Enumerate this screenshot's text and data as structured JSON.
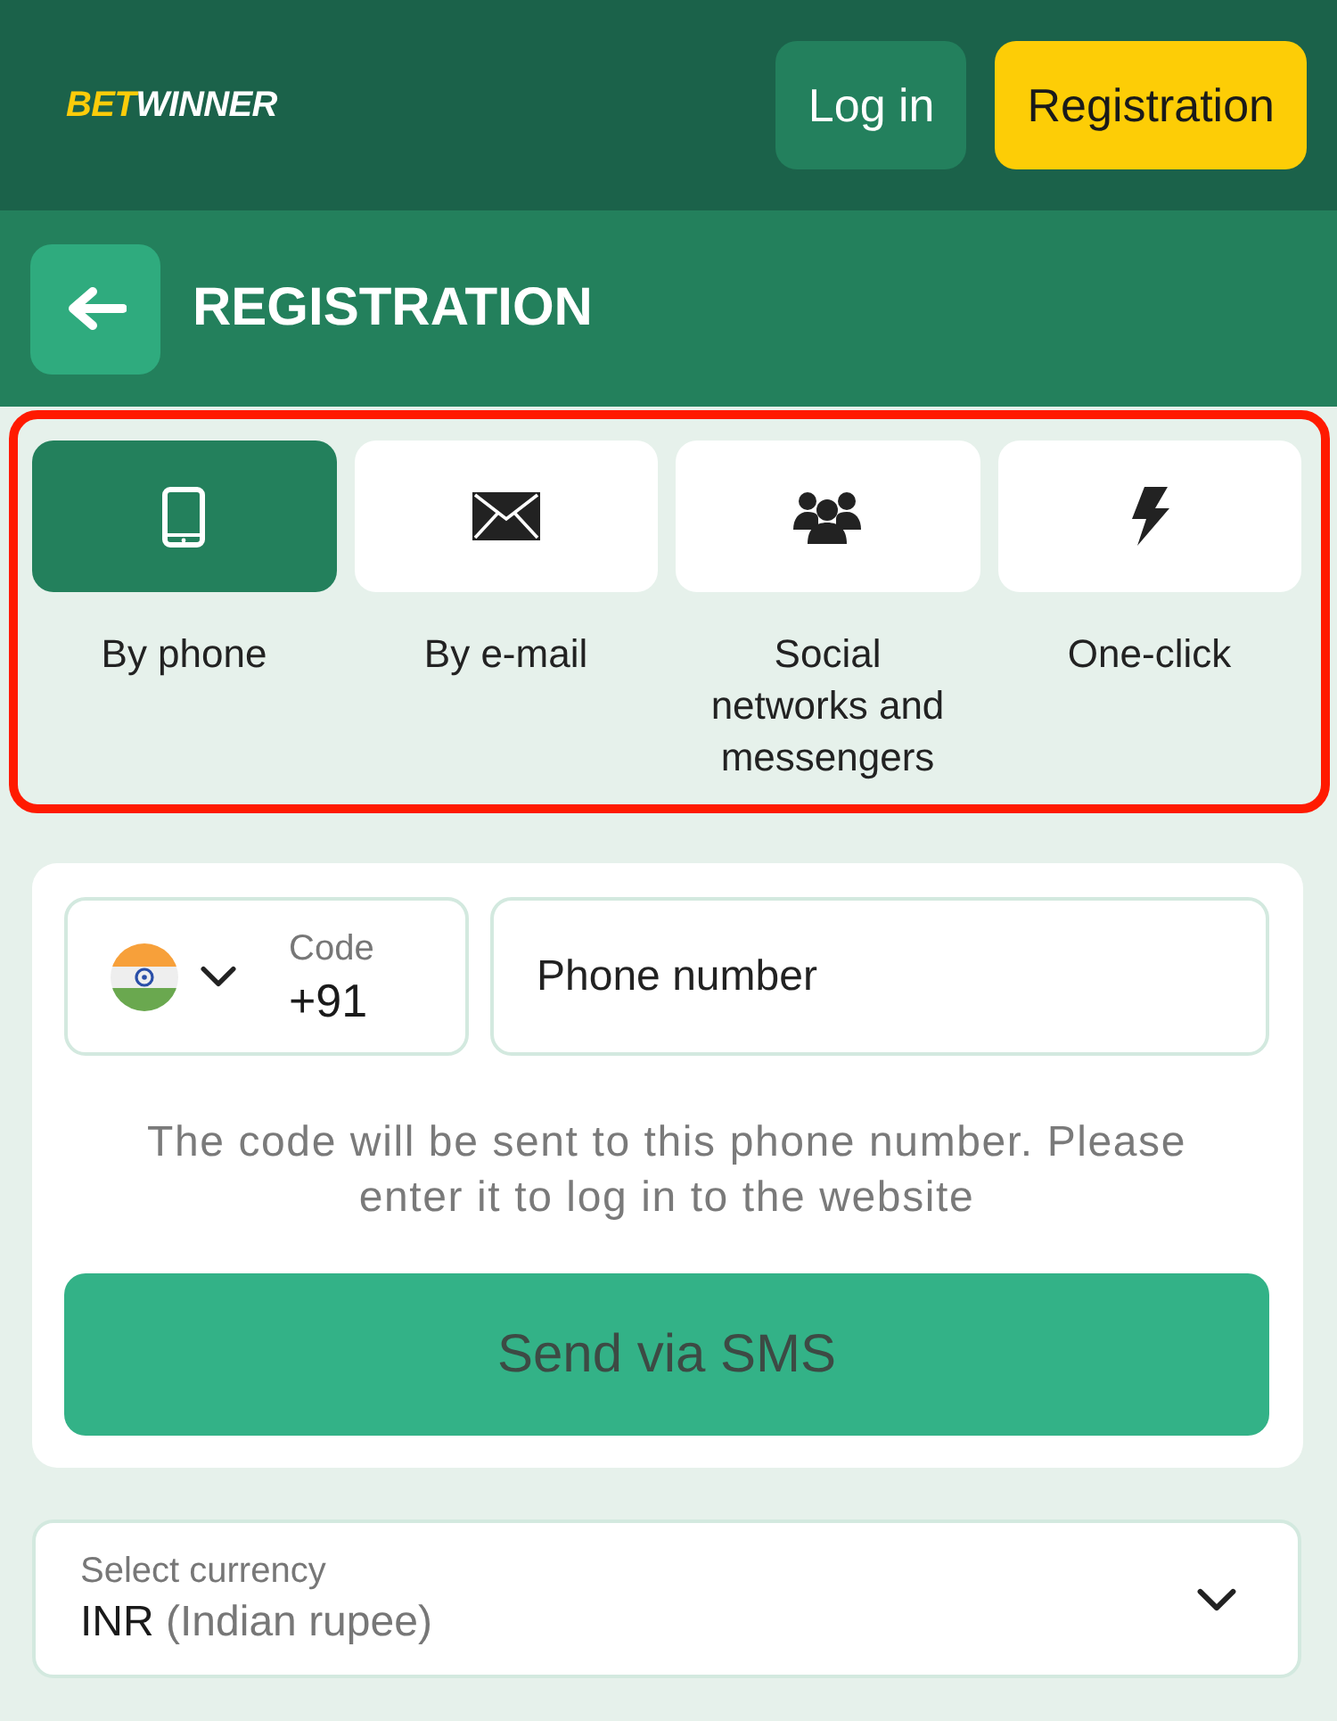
{
  "header": {
    "logo": [
      {
        "text": "BET",
        "color": "#fccc0a"
      },
      {
        "text": "WINNER",
        "color": "#ffffff"
      }
    ],
    "buttons": [
      {
        "label": "Log in",
        "kind": "secondary"
      },
      {
        "label": "Registration",
        "kind": "primary"
      }
    ]
  },
  "title_bar": {
    "title": "REGISTRATION"
  },
  "methods": {
    "highlighted": true,
    "items": [
      {
        "label": "By phone",
        "kind": "phone",
        "selected": true
      },
      {
        "label": "By e-mail",
        "kind": "email",
        "selected": false
      },
      {
        "label": "Social networks and messengers",
        "kind": "social",
        "selected": false
      },
      {
        "label": "One-click",
        "kind": "oneclick",
        "selected": false
      }
    ]
  },
  "phone_form": {
    "country_code": {
      "label": "Code",
      "value": "+91"
    },
    "phone": {
      "placeholder": "Phone number"
    },
    "hint": "The code will be sent to this phone number. Please enter it to log in to the website",
    "button": "Send via SMS"
  },
  "currency": {
    "label": "Select currency",
    "value": "INR",
    "value_detail": "(Indian rupee)"
  }
}
